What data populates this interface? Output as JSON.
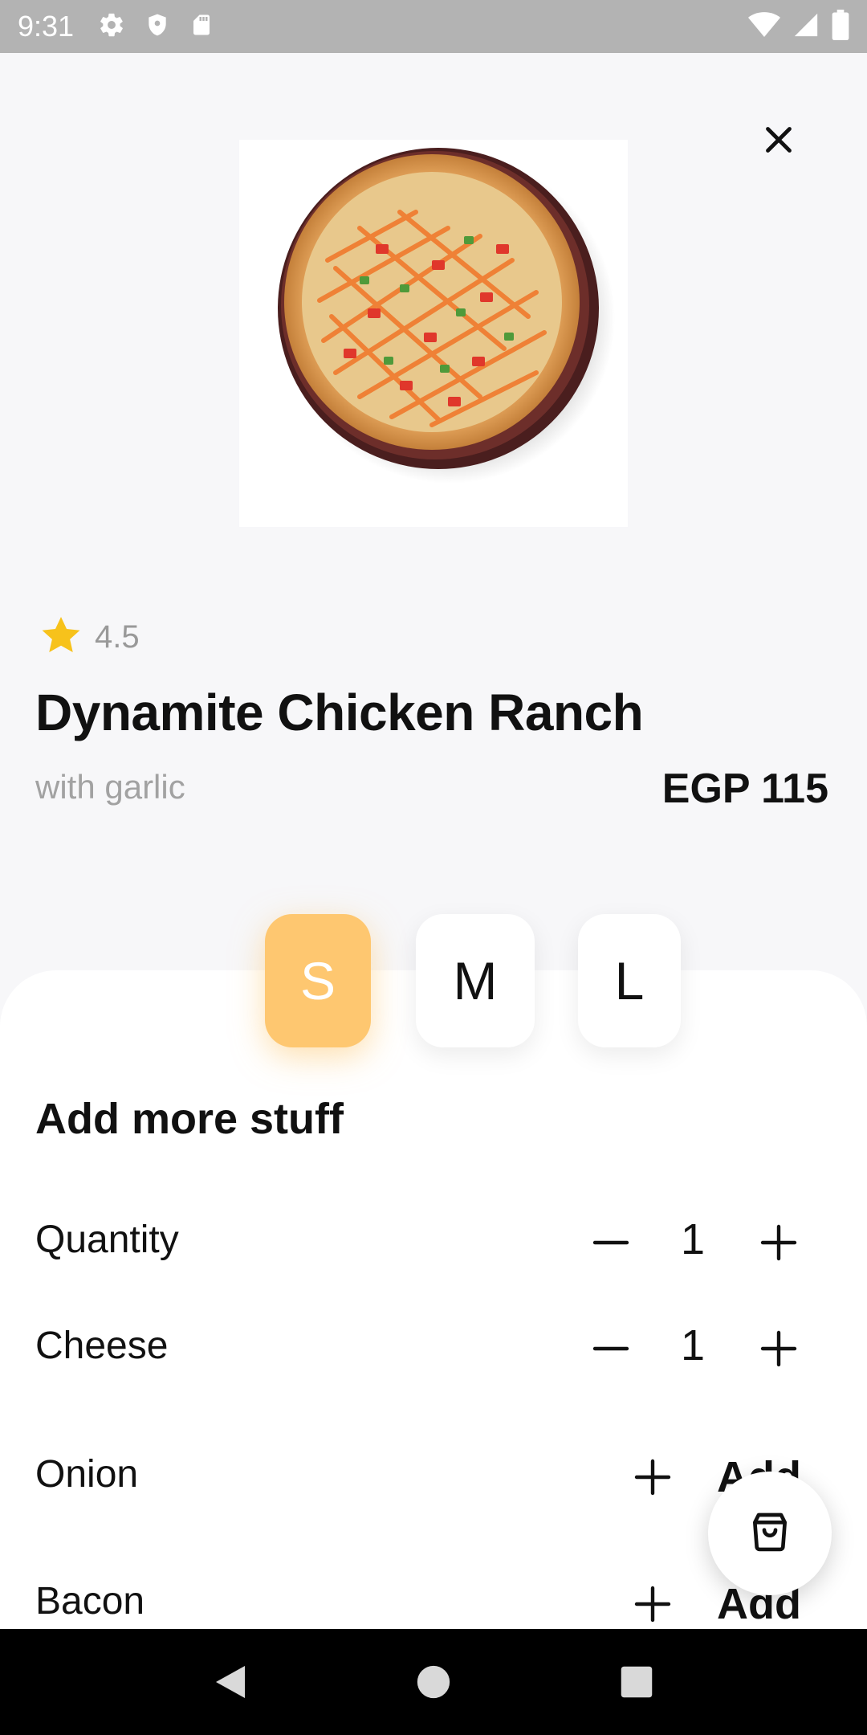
{
  "status_bar": {
    "time": "9:31"
  },
  "product": {
    "rating": "4.5",
    "title": "Dynamite Chicken Ranch",
    "subtitle": "with garlic",
    "price": "EGP 115"
  },
  "sizes": [
    {
      "label": "S",
      "selected": true
    },
    {
      "label": "M",
      "selected": false
    },
    {
      "label": "L",
      "selected": false
    }
  ],
  "extras": {
    "title": "Add more stuff",
    "rows": [
      {
        "label": "Quantity",
        "type": "stepper",
        "value": "1"
      },
      {
        "label": "Cheese",
        "type": "stepper",
        "value": "1"
      },
      {
        "label": "Onion",
        "type": "add",
        "action": "Add"
      },
      {
        "label": "Bacon",
        "type": "add",
        "action": "Add"
      }
    ]
  },
  "colors": {
    "accent": "#fec770",
    "star": "#f7c21b"
  },
  "icons": [
    "settings-icon",
    "shield-icon",
    "sd-card-icon",
    "wifi-icon",
    "signal-icon",
    "battery-icon",
    "close-icon",
    "star-icon",
    "minus-icon",
    "plus-icon",
    "shopping-bag-icon",
    "back-icon",
    "home-icon",
    "recents-icon"
  ]
}
